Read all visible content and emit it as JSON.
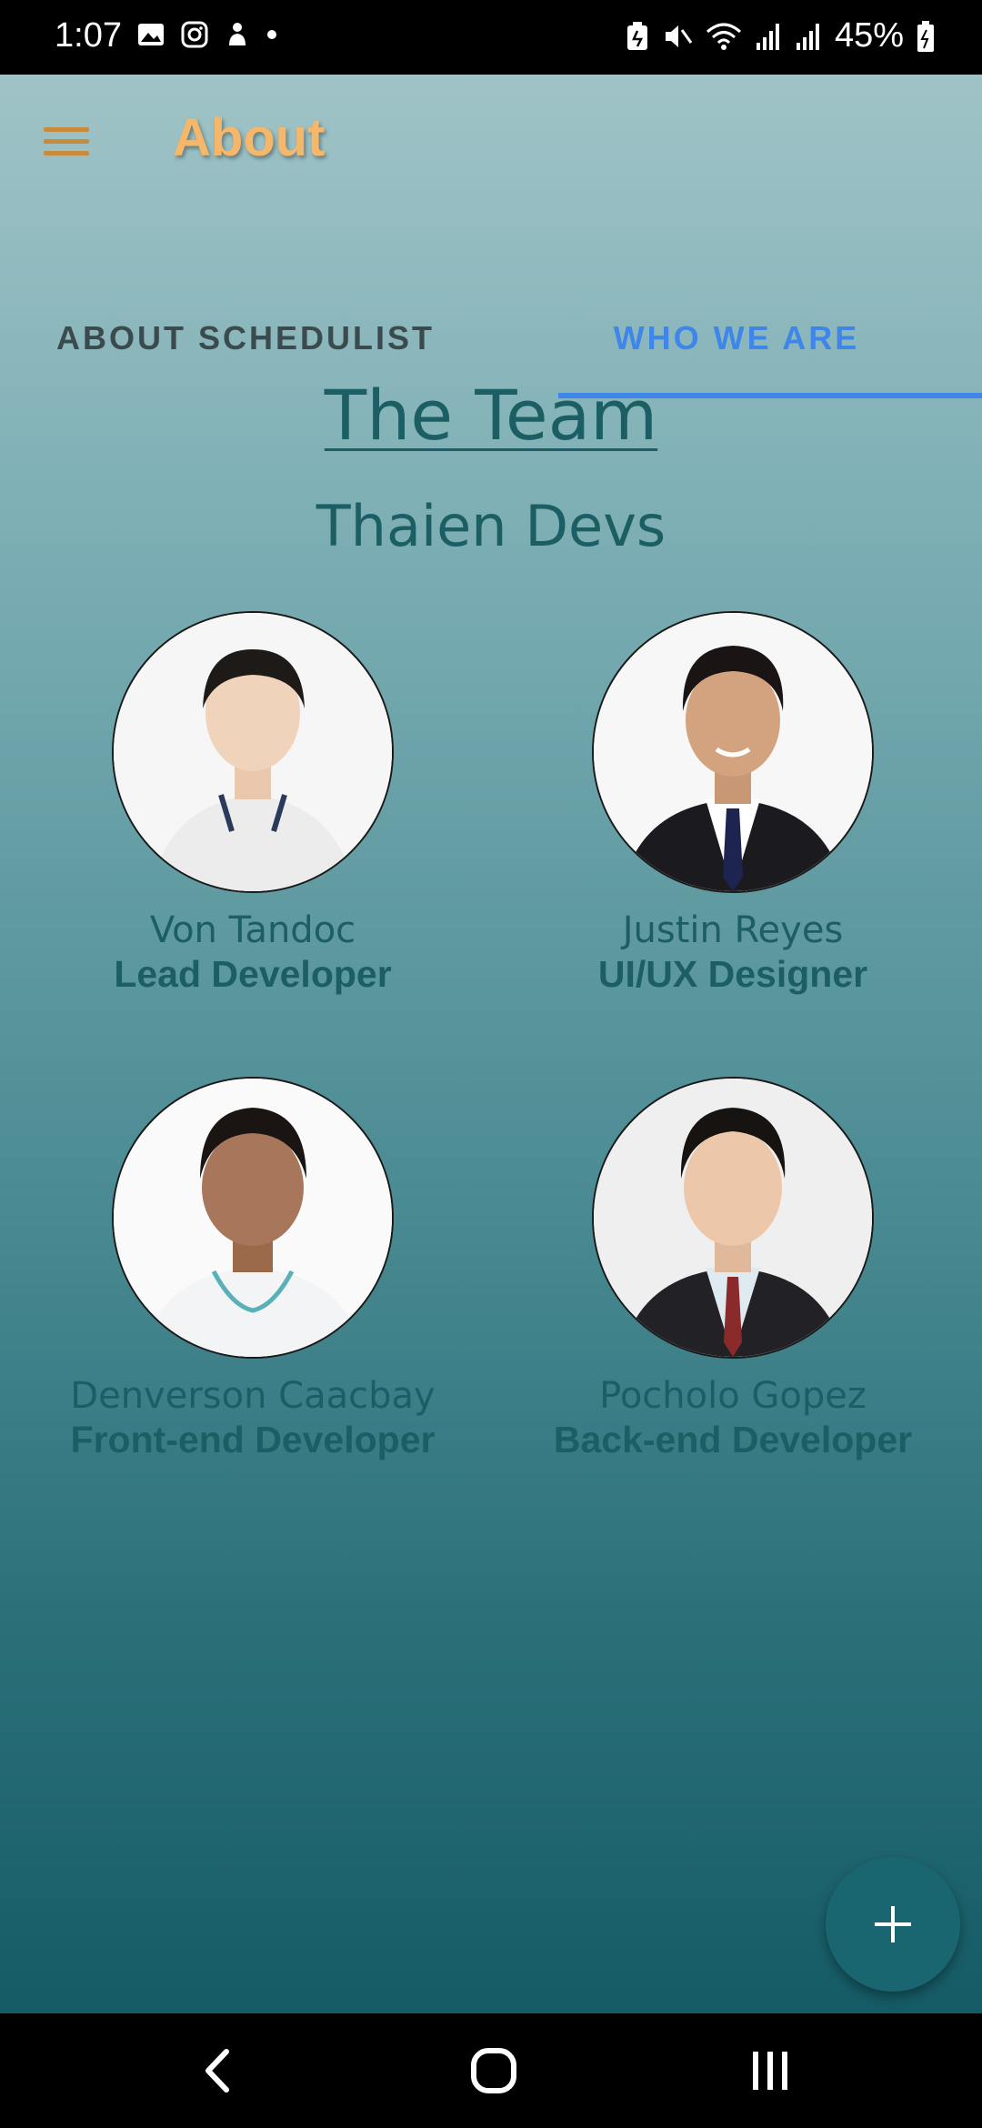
{
  "status_bar": {
    "time": "1:07",
    "battery": "45%",
    "left_icons": [
      "gallery-icon",
      "instagram-icon",
      "notification-icon",
      "dot-icon"
    ],
    "right_icons": [
      "battery-saver-icon",
      "mute-icon",
      "wifi-icon",
      "signal-icon",
      "signal-icon",
      "battery-icon"
    ]
  },
  "toolbar": {
    "title": "About",
    "title_color": "#f6b76a",
    "menu_icon": "hamburger-menu-icon"
  },
  "tabs": [
    {
      "label": "ABOUT SCHEDULIST",
      "selected": false
    },
    {
      "label": "WHO WE ARE",
      "selected": true
    }
  ],
  "accent_color": "#3e86ea",
  "section": {
    "title": "The Team",
    "subtitle": "Thaien Devs"
  },
  "members": [
    {
      "name": "Von Tandoc",
      "role": "Lead Developer"
    },
    {
      "name": "Justin Reyes",
      "role": "UI/UX Designer"
    },
    {
      "name": "Denverson Caacbay",
      "role": "Front-end Developer"
    },
    {
      "name": "Pocholo Gopez",
      "role": "Back-end Developer"
    }
  ],
  "fab": {
    "icon": "plus-icon"
  },
  "nav_bar": {
    "buttons": [
      "back-icon",
      "home-icon",
      "recents-icon"
    ]
  }
}
